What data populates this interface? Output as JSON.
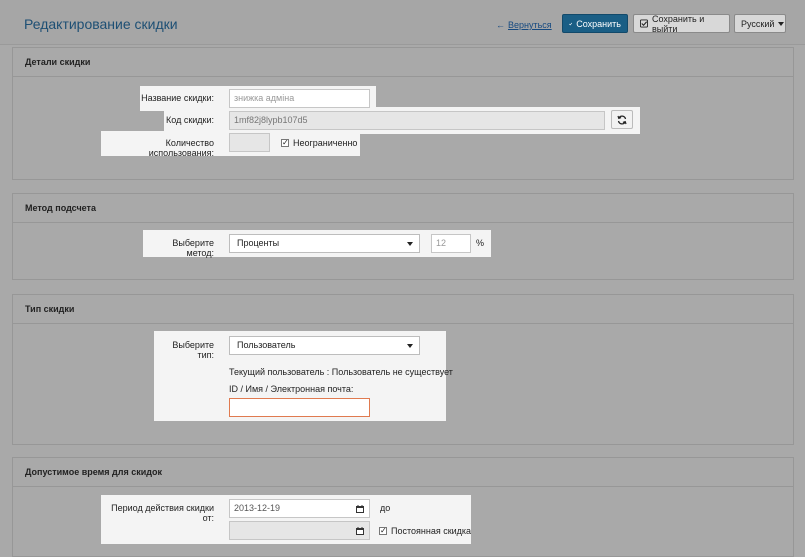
{
  "header": {
    "title": "Редактирование скидки",
    "back_label": "Вернуться",
    "save_label": "Сохранить",
    "save_exit_label": "Сохранить и выйти",
    "language_label": "Русский"
  },
  "details": {
    "heading": "Детали скидки",
    "name_label": "Название скидки:",
    "name_value": "знижка адміна",
    "code_label": "Код скидки:",
    "code_value": "1mf82j8lypb107d5",
    "usage_label": "Количество использования:",
    "usage_value": "",
    "unlimited_label": "Неограниченно",
    "unlimited_checked": true
  },
  "method": {
    "heading": "Метод подсчета",
    "choose_label": "Выберите метод:",
    "selected": "Проценты",
    "value": "12",
    "unit": "%"
  },
  "type": {
    "heading": "Тип скидки",
    "choose_label": "Выберите тип:",
    "selected": "Пользователь",
    "current_user_text": "Текущий пользователь : Пользователь не существует",
    "lookup_label": "ID / Имя / Электронная почта:",
    "lookup_value": ""
  },
  "period": {
    "heading": "Допустимое время для скидок",
    "from_label": "Период действия скидки от:",
    "from_value": "2013-12-19",
    "to_label": "до",
    "to_value": "",
    "permanent_label": "Постоянная скидка",
    "permanent_checked": true
  },
  "colors": {
    "accent": "#1a5e85",
    "title": "#1d4f74",
    "lookup_border": "#e07a4f"
  }
}
